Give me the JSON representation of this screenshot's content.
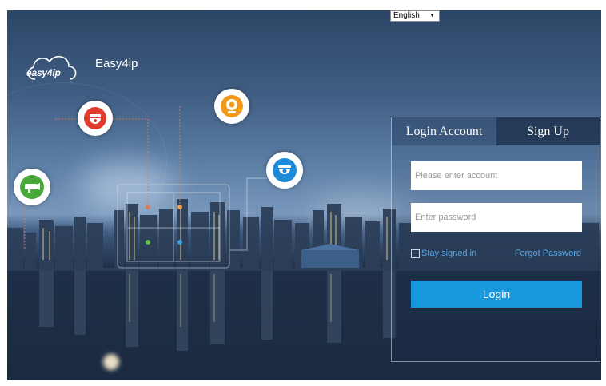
{
  "language": {
    "selected": "English"
  },
  "logo": {
    "text": "easy4ip"
  },
  "brand": {
    "name": "Easy4ip"
  },
  "login_panel": {
    "tabs": [
      {
        "label": "Login Account",
        "active": true
      },
      {
        "label": "Sign Up",
        "active": false
      }
    ],
    "account_placeholder": "Please enter account",
    "password_placeholder": "Enter password",
    "remember_label": "Stay signed in",
    "forgot_label": "Forgot Password",
    "login_label": "Login"
  },
  "colors": {
    "accent": "#1898dc",
    "link": "#5aa8e6",
    "speed_dome_icon": "#e23b2e",
    "ip_camera_icon": "#f29a1a",
    "dome_camera_icon": "#1c8ad6",
    "bullet_camera_icon": "#49a83a"
  },
  "icons": [
    "speed-dome-camera-icon",
    "ip-camera-icon",
    "dome-camera-icon",
    "bullet-camera-icon"
  ]
}
